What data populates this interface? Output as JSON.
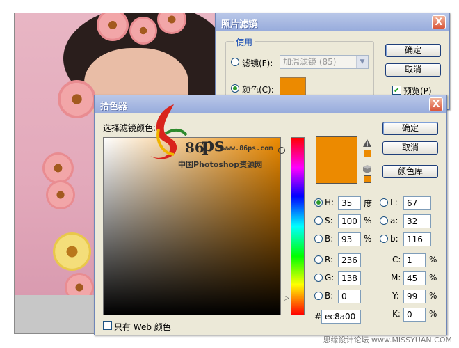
{
  "filter_dialog": {
    "title": "照片滤镜",
    "close": "X",
    "group_label": "使用",
    "filter_option_label": "滤镜(F):",
    "filter_select_value": "加温滤镜 (85)",
    "color_option_label": "颜色(C):",
    "ok": "确定",
    "cancel": "取消",
    "preview_label": "预览(P)",
    "preview_checked": true,
    "selected_option": "color"
  },
  "picker_dialog": {
    "title": "拾色器",
    "close": "X",
    "prompt": "选择滤镜颜色:",
    "ok": "确定",
    "cancel": "取消",
    "libraries": "颜色库",
    "web_only_label": "只有 Web 颜色",
    "web_only_checked": false,
    "current_color": "#ec8a00",
    "selected_model": "H",
    "fields": {
      "H": {
        "label": "H:",
        "value": "35",
        "unit": "度"
      },
      "S": {
        "label": "S:",
        "value": "100",
        "unit": "%"
      },
      "B": {
        "label": "B:",
        "value": "93",
        "unit": "%"
      },
      "R": {
        "label": "R:",
        "value": "236",
        "unit": ""
      },
      "G": {
        "label": "G:",
        "value": "138",
        "unit": ""
      },
      "Bl": {
        "label": "B:",
        "value": "0",
        "unit": ""
      },
      "L": {
        "label": "L:",
        "value": "67",
        "unit": ""
      },
      "a": {
        "label": "a:",
        "value": "32",
        "unit": ""
      },
      "b": {
        "label": "b:",
        "value": "116",
        "unit": ""
      },
      "C": {
        "label": "C:",
        "value": "1",
        "unit": "%"
      },
      "M": {
        "label": "M:",
        "value": "45",
        "unit": "%"
      },
      "Y": {
        "label": "Y:",
        "value": "99",
        "unit": "%"
      },
      "K": {
        "label": "K:",
        "value": "0",
        "unit": "%"
      }
    },
    "hex_label": "#",
    "hex_value": "ec8a00"
  },
  "watermark": {
    "logo_86": "86",
    "logo_ps": "ps",
    "url": "www.86ps.com",
    "site_name": "中国Photoshop资源网"
  },
  "credit": "思缘设计论坛 www.MISSYUAN.COM"
}
